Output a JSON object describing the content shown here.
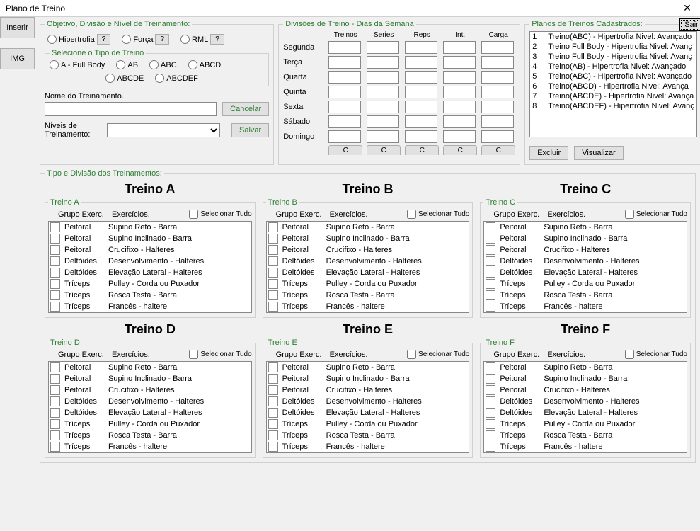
{
  "window": {
    "title": "Plano de Treino"
  },
  "leftbar": {
    "inserir": "Inserir",
    "img": "IMG"
  },
  "sair": "Sair",
  "objetivo": {
    "legend": "Objetivo, Divisão e Nível de Treinamento:",
    "hipertrofia": "Hipertrofia",
    "forca": "Força",
    "rml": "RML",
    "q": "?",
    "tipo_legend": "Selecione o Tipo de Treino",
    "tipo_a": "A - Full Body",
    "tipo_ab": "AB",
    "tipo_abc": "ABC",
    "tipo_abcd": "ABCD",
    "tipo_abcde": "ABCDE",
    "tipo_abcdef": "ABCDEF",
    "nome_label": "Nome do Treinamento.",
    "niveis_label": "Níveis de Treinamento:",
    "cancelar": "Cancelar",
    "salvar": "Salvar"
  },
  "divisoes": {
    "legend": "Divisões de Treino - Dias da Semana",
    "hdr_treinos": "Treinos",
    "hdr_series": "Series",
    "hdr_reps": "Reps",
    "hdr_int": "Int.",
    "hdr_carga": "Carga",
    "days": [
      "Segunda",
      "Terça",
      "Quarta",
      "Quinta",
      "Sexta",
      "Sábado",
      "Domingo"
    ],
    "c": "C"
  },
  "planos": {
    "legend": "Planos de Treinos Cadastrados:",
    "list": [
      {
        "n": "1",
        "t": "Treino(ABC) - Hipertrofia Nivel: Avançado"
      },
      {
        "n": "2",
        "t": "Treino Full Body - Hipertrofia Nivel: Avanç"
      },
      {
        "n": "3",
        "t": "Treino Full Body - Hipertrofia Nivel: Avanç"
      },
      {
        "n": "4",
        "t": "Treino(AB) - Hipertrofia Nivel: Avançado"
      },
      {
        "n": "5",
        "t": "Treino(ABC) - Hipertrofia Nivel: Avançado"
      },
      {
        "n": "6",
        "t": "Treino(ABCD) - Hipertrofia Nivel: Avança"
      },
      {
        "n": "7",
        "t": "Treino(ABCDE) - Hipertrofia Nivel: Avança"
      },
      {
        "n": "8",
        "t": "Treino(ABCDEF) - Hipertrofia Nivel: Avanç"
      }
    ],
    "excluir": "Excluir",
    "visualizar": "Visualizar"
  },
  "tipodiv": {
    "legend": "Tipo e Divisão dos Treinamentos:",
    "hdr_grupo": "Grupo Exerc.",
    "hdr_ex": "Exercícios.",
    "sel_tudo": "Selecionar Tudo",
    "sections": [
      {
        "head": "Treino A",
        "leg": "Treino A"
      },
      {
        "head": "Treino B",
        "leg": "Treino B"
      },
      {
        "head": "Treino C",
        "leg": "Treino C"
      },
      {
        "head": "Treino D",
        "leg": "Treino D"
      },
      {
        "head": "Treino E",
        "leg": "Treino E"
      },
      {
        "head": "Treino F",
        "leg": "Treino F"
      }
    ],
    "exercises": [
      {
        "g": "Peitoral",
        "e": "Supino Reto - Barra"
      },
      {
        "g": "Peitoral",
        "e": "Supino Inclinado - Barra"
      },
      {
        "g": "Peitoral",
        "e": "Crucifixo - Halteres"
      },
      {
        "g": "Deltóides",
        "e": "Desenvolvimento - Halteres"
      },
      {
        "g": "Deltóides",
        "e": "Elevação Lateral - Halteres"
      },
      {
        "g": "Tríceps",
        "e": "Pulley - Corda ou Puxador"
      },
      {
        "g": "Tríceps",
        "e": "Rosca Testa - Barra"
      },
      {
        "g": "Tríceps",
        "e": "Francês - haltere"
      }
    ]
  }
}
